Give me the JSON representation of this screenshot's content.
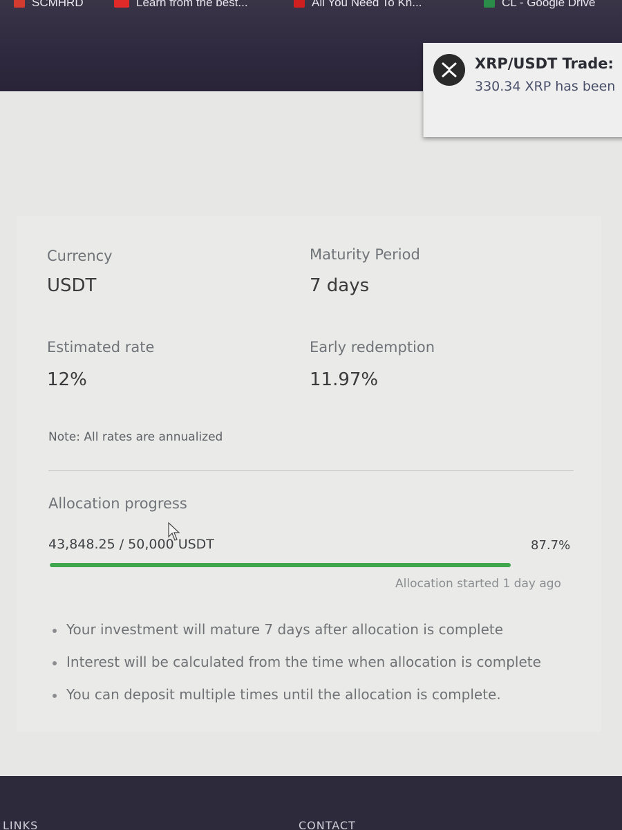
{
  "bookmarks": [
    {
      "label": "SCMHRD",
      "color": "#d23b2f"
    },
    {
      "label": "Learn from the best...",
      "color": "#e02a2a"
    },
    {
      "label": "All You Need To Kn...",
      "color": "#d01f1f"
    },
    {
      "label": "CL - Google Drive",
      "color": "#2b8c4a"
    }
  ],
  "toast": {
    "title": "XRP/USDT Trade:",
    "message": "330.34 XRP has been",
    "icon": "xrp-icon"
  },
  "details": {
    "currency_label": "Currency",
    "currency_value": "USDT",
    "maturity_label": "Maturity Period",
    "maturity_value": "7 days",
    "rate_label": "Estimated rate",
    "rate_value": "12%",
    "early_label": "Early redemption",
    "early_value": "11.97%",
    "note": "Note: All rates are annualized"
  },
  "allocation": {
    "label": "Allocation progress",
    "amount": "43,848.25 / 50,000 USDT",
    "percent": "87.7%",
    "progress": 0.877,
    "started": "Allocation started 1 day ago",
    "bar_color": "#3ea64d"
  },
  "bullets": [
    "Your investment will mature 7 days after allocation is complete",
    "Interest will be calculated from the time when allocation is complete",
    "You can deposit multiple times until the allocation is complete."
  ],
  "footer": {
    "links_label": "LINKS",
    "contact_label": "CONTACT"
  }
}
